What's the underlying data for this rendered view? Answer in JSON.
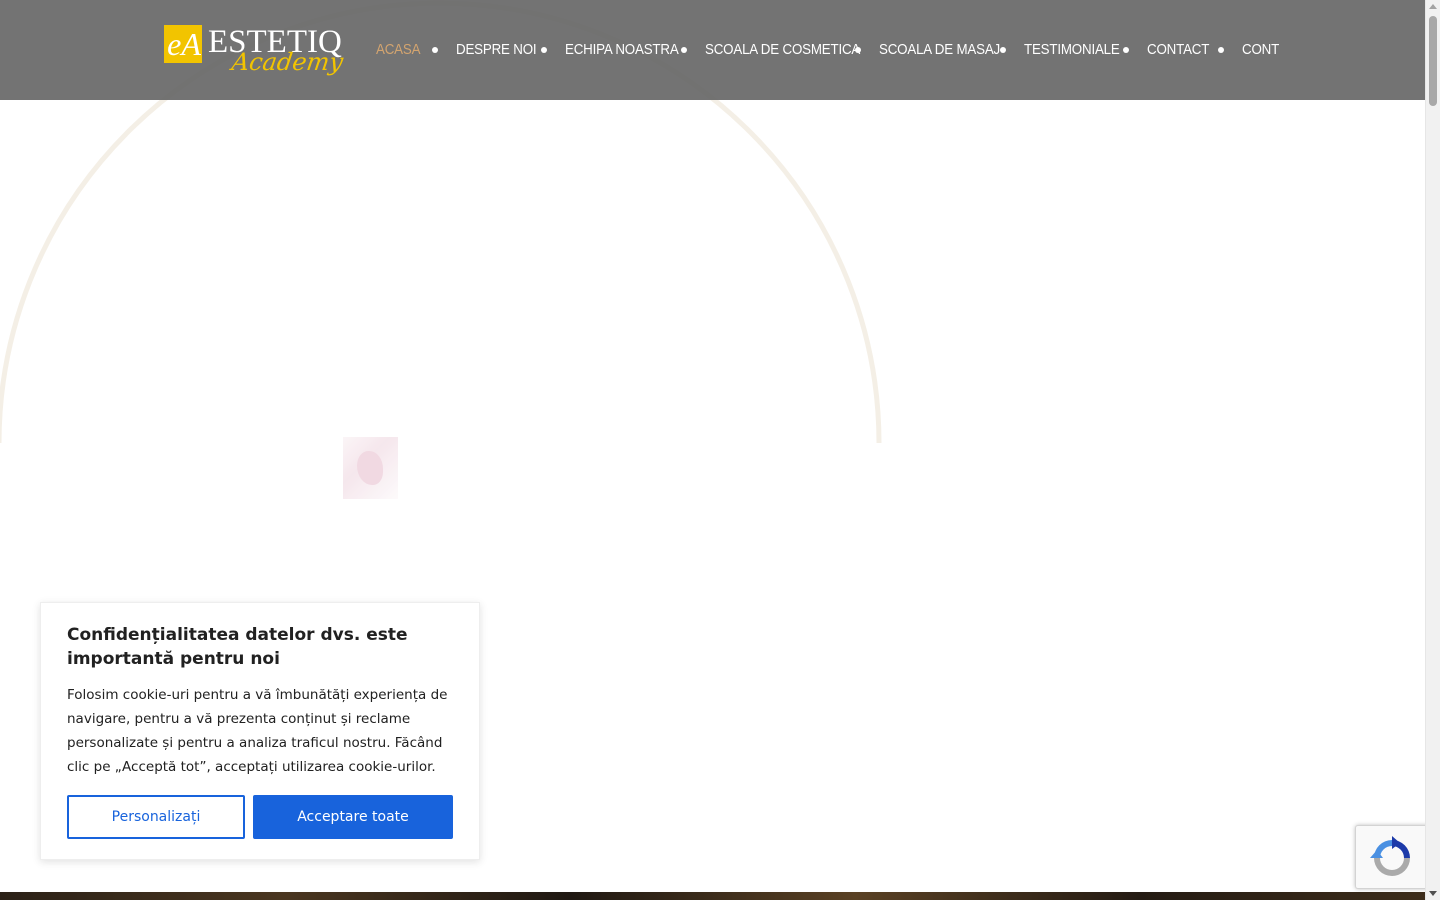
{
  "header": {
    "logo": {
      "mark": "eA",
      "wordmark": "ESTETIQ",
      "script": "Academy"
    },
    "nav": [
      {
        "label": "ACASA",
        "active": true
      },
      {
        "label": "DESPRE NOI",
        "active": false
      },
      {
        "label": "ECHIPA NOASTRA",
        "active": false
      },
      {
        "label": "SCOALA DE COSMETICA",
        "active": false
      },
      {
        "label": "SCOALA DE MASAJ",
        "active": false
      },
      {
        "label": "TESTIMONIALE",
        "active": false
      },
      {
        "label": "CONTACT",
        "active": false
      },
      {
        "label": "CONT",
        "active": false
      }
    ]
  },
  "cookie_banner": {
    "title": "Confidențialitatea datelor dvs. este importantă pentru noi",
    "text": "Folosim cookie-uri pentru a vă îmbunătăți experiența de navigare, pentru a vă prezenta conținut și reclame personalizate și pentru a analiza traficul nostru. Făcând clic pe „Acceptă tot”, acceptați utilizarea cookie-urilor.",
    "customize_label": "Personalizați",
    "accept_label": "Acceptare toate"
  },
  "icons": {
    "recaptcha": "recaptcha-icon"
  },
  "colors": {
    "header_bg": "#646464",
    "nav_active": "#d3a46f",
    "logo_gold": "#f2c400",
    "button_blue": "#1863dc",
    "arc": "#f4efe6"
  }
}
